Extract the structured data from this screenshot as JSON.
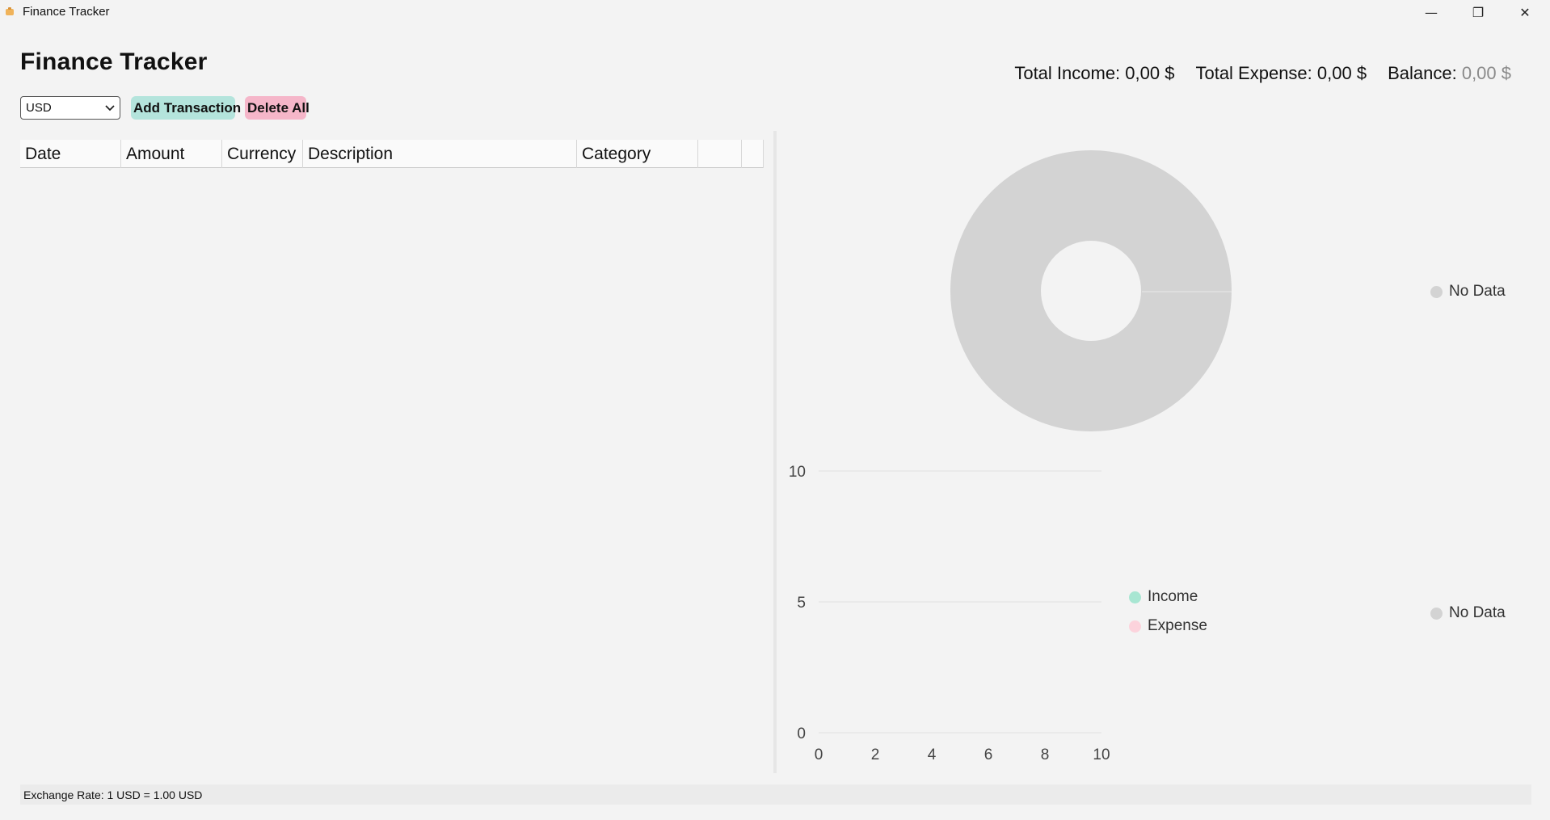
{
  "window": {
    "title": "Finance Tracker",
    "minimize_glyph": "—",
    "maximize_glyph": "❐",
    "close_glyph": "✕"
  },
  "header": {
    "title": "Finance Tracker",
    "total_income_label": "Total Income:",
    "total_income_value": "0,00 $",
    "total_expense_label": "Total Expense:",
    "total_expense_value": "0,00 $",
    "balance_label": "Balance:",
    "balance_value": "0,00 $"
  },
  "controls": {
    "currency_selected": "USD",
    "add_label": "Add Transaction",
    "delete_label": "Delete All"
  },
  "table": {
    "columns": [
      "Date",
      "Amount",
      "Currency",
      "Description",
      "Category",
      "",
      ""
    ],
    "rows": []
  },
  "donut_chart": {
    "legend_label": "No Data",
    "color": "#d3d3d3"
  },
  "bar_chart": {
    "legend_income": "Income",
    "legend_expense": "Expense",
    "legend_nodata": "No Data",
    "income_color": "#a8e6d2",
    "expense_color": "#fcd3dc",
    "nodata_color": "#d3d3d3",
    "y_ticks": [
      "10",
      "5",
      "0"
    ],
    "x_ticks": [
      "0",
      "2",
      "4",
      "6",
      "8",
      "10"
    ]
  },
  "chart_data": [
    {
      "type": "pie",
      "labels": [
        "No Data"
      ],
      "values": [
        1
      ]
    },
    {
      "type": "bar",
      "series": [
        {
          "name": "Income",
          "values": []
        },
        {
          "name": "Expense",
          "values": []
        }
      ],
      "xlim": [
        0,
        10
      ],
      "ylim": [
        0,
        10
      ],
      "grid": true
    }
  ],
  "footer": {
    "exchange_rate": "Exchange Rate: 1 USD = 1.00 USD"
  },
  "colors": {
    "add_button": "#b4e4dc",
    "delete_button": "#f5b6c9",
    "balance_text": "#8a8a8a"
  }
}
